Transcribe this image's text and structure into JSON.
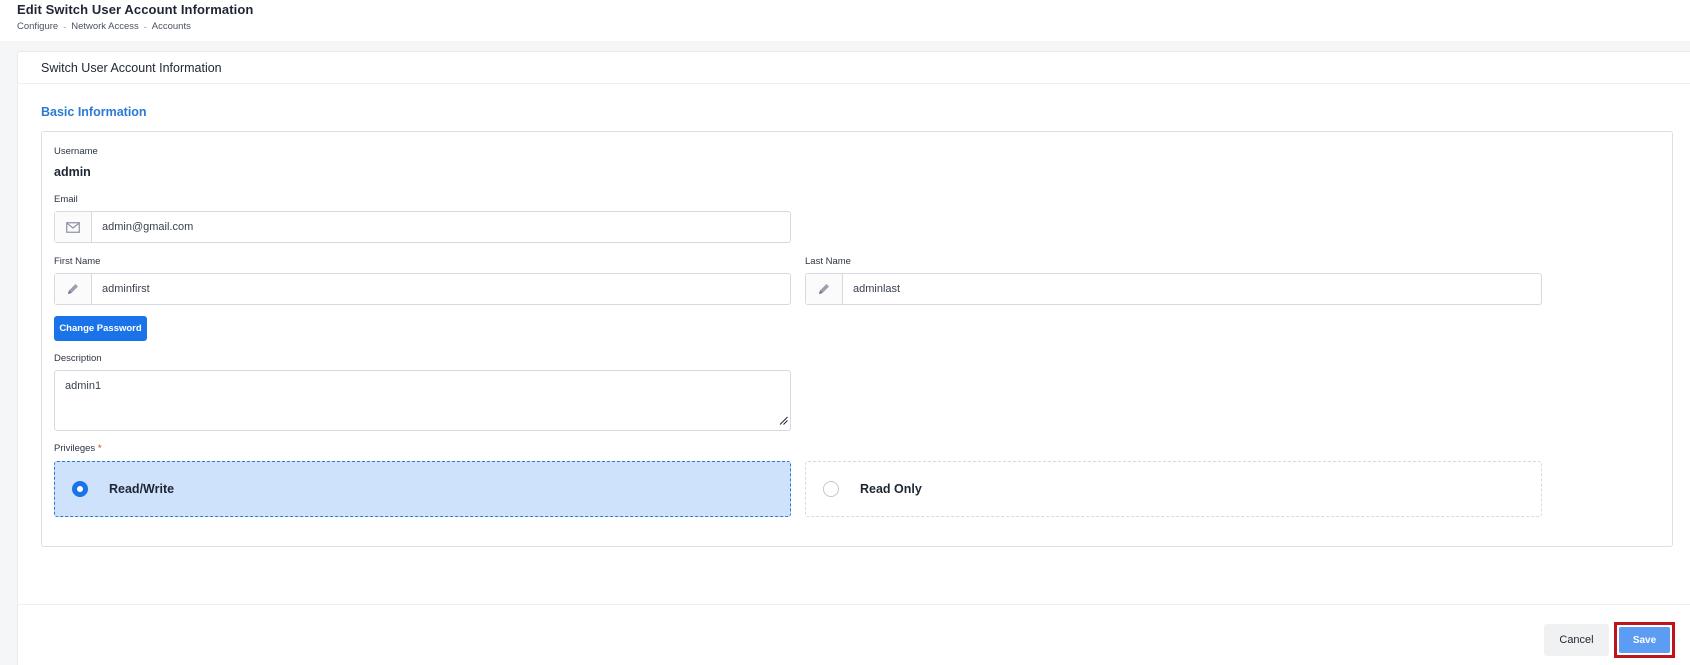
{
  "header": {
    "title": "Edit Switch User Account Information",
    "breadcrumb": [
      "Configure",
      "Network Access",
      "Accounts"
    ],
    "separator": "-"
  },
  "card": {
    "title": "Switch User Account Information",
    "section_title": "Basic Information"
  },
  "form": {
    "username_label": "Username",
    "username_value": "admin",
    "email_label": "Email",
    "email_value": "admin@gmail.com",
    "email_icon": "mail-icon",
    "first_name_label": "First Name",
    "first_name_value": "adminfirst",
    "last_name_label": "Last Name",
    "last_name_value": "adminlast",
    "name_icon": "pencil-icon",
    "change_password_label": "Change Password",
    "description_label": "Description",
    "description_value": "admin1",
    "privileges_label": "Privileges",
    "required_mark": "*",
    "privileges_options": [
      {
        "label": "Read/Write",
        "selected": true
      },
      {
        "label": "Read Only",
        "selected": false
      }
    ]
  },
  "footer": {
    "cancel_label": "Cancel",
    "save_label": "Save"
  },
  "colors": {
    "accent": "#1a73e8",
    "section_title": "#2a7ad6",
    "selected_card_bg": "#cfe2fb",
    "highlight": "#c0141b"
  }
}
